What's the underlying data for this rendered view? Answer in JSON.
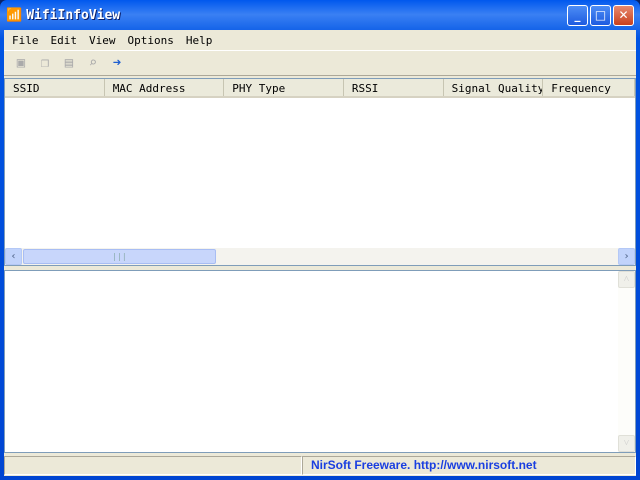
{
  "window": {
    "title": "WifiInfoView"
  },
  "menu": [
    "File",
    "Edit",
    "View",
    "Options",
    "Help"
  ],
  "columns": [
    "SSID",
    "MAC Address",
    "PHY Type",
    "RSSI",
    "Signal Quality",
    "Frequency"
  ],
  "status": {
    "left": "",
    "link": "NirSoft Freeware.  http://www.nirsoft.net"
  }
}
